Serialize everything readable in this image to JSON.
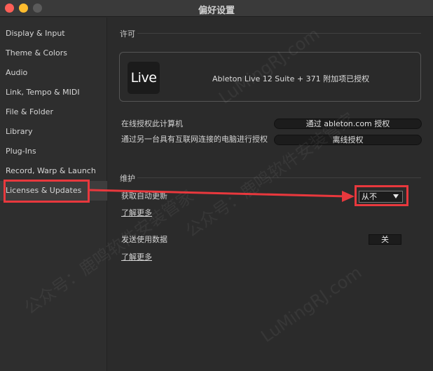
{
  "window": {
    "title": "偏好设置"
  },
  "sidebar": {
    "items": [
      {
        "label": "Display & Input"
      },
      {
        "label": "Theme & Colors"
      },
      {
        "label": "Audio"
      },
      {
        "label": "Link, Tempo & MIDI"
      },
      {
        "label": "File & Folder"
      },
      {
        "label": "Library"
      },
      {
        "label": "Plug-Ins"
      },
      {
        "label": "Record, Warp & Launch"
      },
      {
        "label": "Licenses & Updates",
        "selected": true
      }
    ]
  },
  "license": {
    "section_title": "许可",
    "logo_text": "Live",
    "product_text": "Ableton Live 12 Suite + 371 附加项已授权",
    "authorize_online_label": "在线授权此计算机",
    "authorize_online_button": "通过 ableton.com 授权",
    "authorize_offline_label": "通过另一台具有互联网连接的电脑进行授权",
    "authorize_offline_button": "离线授权"
  },
  "maintenance": {
    "section_title": "维护",
    "auto_update_label": "获取自动更新",
    "auto_update_value": "从不",
    "learn_more_1": "了解更多",
    "usage_data_label": "发送使用数据",
    "usage_data_value": "关",
    "learn_more_2": "了解更多"
  },
  "colors": {
    "highlight": "#e8383d",
    "background": "#2b2b2b"
  },
  "watermark": {
    "text_1": "公众号：鹿鸣软件安装管家",
    "text_2": "LuMingRJ.com"
  }
}
